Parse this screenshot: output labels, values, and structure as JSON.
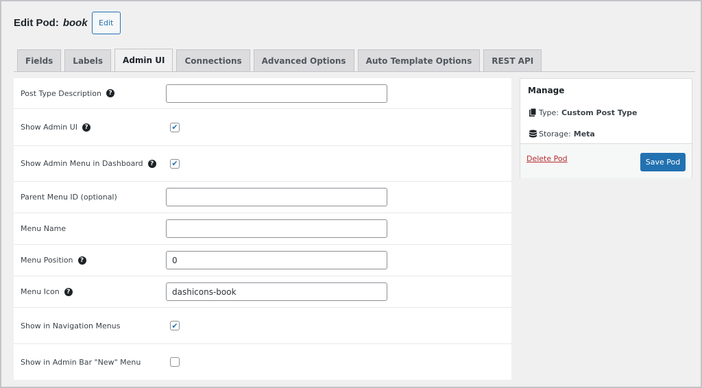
{
  "header": {
    "title": "Edit Pod:",
    "pod_name": "book",
    "edit_label": "Edit"
  },
  "tabs": [
    {
      "label": "Fields",
      "active": false
    },
    {
      "label": "Labels",
      "active": false
    },
    {
      "label": "Admin UI",
      "active": true
    },
    {
      "label": "Connections",
      "active": false
    },
    {
      "label": "Advanced Options",
      "active": false
    },
    {
      "label": "Auto Template Options",
      "active": false
    },
    {
      "label": "REST API",
      "active": false
    }
  ],
  "form": {
    "post_type_description": {
      "label": "Post Type Description",
      "value": ""
    },
    "show_admin_ui": {
      "label": "Show Admin UI",
      "checked": true
    },
    "show_admin_menu": {
      "label": "Show Admin Menu in Dashboard",
      "checked": true
    },
    "parent_menu_id": {
      "label": "Parent Menu ID (optional)",
      "value": ""
    },
    "menu_name": {
      "label": "Menu Name",
      "value": ""
    },
    "menu_position": {
      "label": "Menu Position",
      "value": "0"
    },
    "menu_icon": {
      "label": "Menu Icon",
      "value": "dashicons-book"
    },
    "show_in_nav_menus": {
      "label": "Show in Navigation Menus",
      "checked": true
    },
    "show_in_admin_bar": {
      "label": "Show in Admin Bar \"New\" Menu",
      "checked": false
    }
  },
  "help_glyph": "?",
  "check_glyph": "✔",
  "sidebar": {
    "title": "Manage",
    "type_label": "Type:",
    "type_value": "Custom Post Type",
    "storage_label": "Storage:",
    "storage_value": "Meta",
    "delete_label": "Delete Pod",
    "save_label": "Save Pod"
  },
  "colors": {
    "primary": "#2271b1",
    "delete": "#b32d2e",
    "background": "#f0f0f1"
  }
}
